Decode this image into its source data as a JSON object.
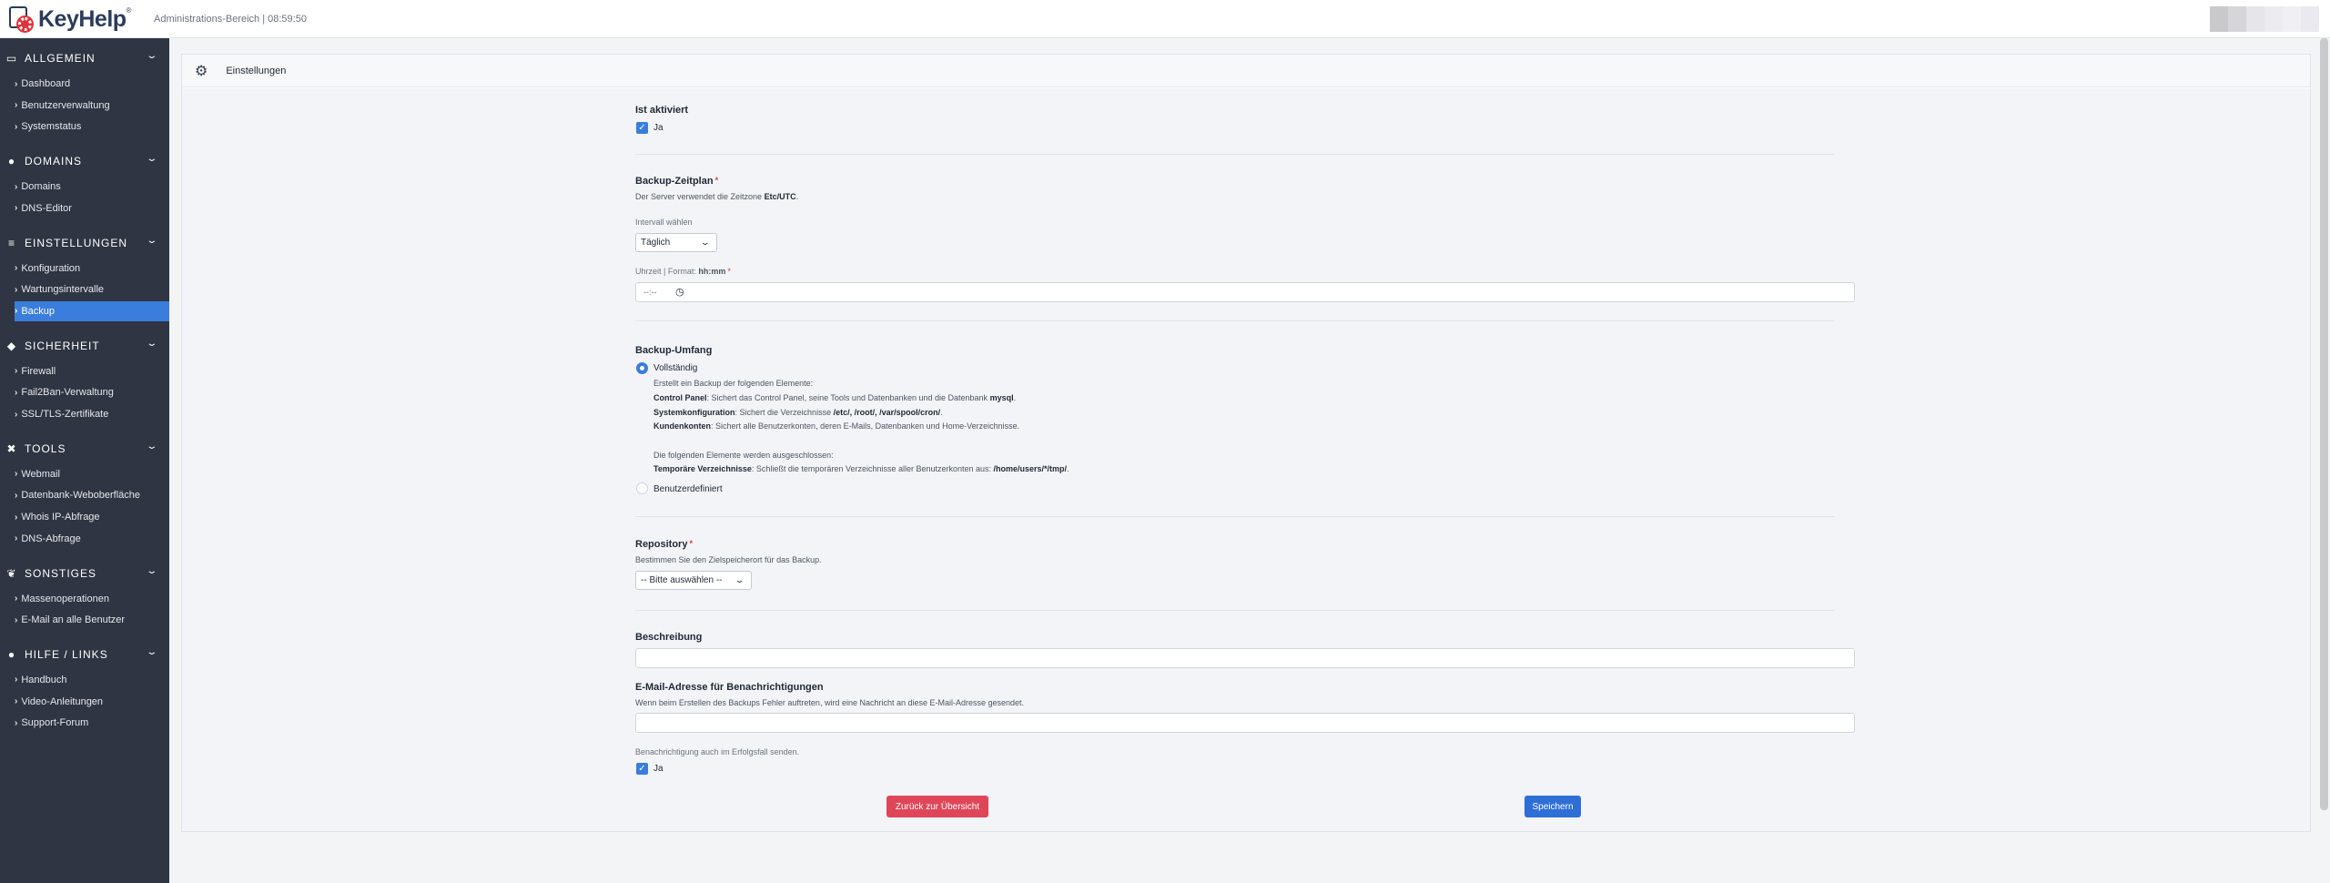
{
  "header": {
    "logo_text": "KeyHelp",
    "logo_mark": "®",
    "subtitle": "Administrations-Bereich | 08:59:50",
    "avatar_colors": [
      "#c9c9cc",
      "#d6d6d9",
      "#e6e6ea",
      "#ececf0",
      "#f0f0f4",
      "#e9e9ef"
    ]
  },
  "sidebar": {
    "sections": [
      {
        "title": "ALLGEMEIN",
        "icon": "monitor-icon",
        "glyph": "▭",
        "items": [
          "Dashboard",
          "Benutzerverwaltung",
          "Systemstatus"
        ]
      },
      {
        "title": "DOMAINS",
        "icon": "globe-icon",
        "glyph": "●",
        "items": [
          "Domains",
          "DNS-Editor"
        ]
      },
      {
        "title": "EINSTELLUNGEN",
        "icon": "sliders-icon",
        "glyph": "≡",
        "items": [
          "Konfiguration",
          "Wartungsintervalle",
          "Backup"
        ]
      },
      {
        "title": "SICHERHEIT",
        "icon": "shield-icon",
        "glyph": "◆",
        "items": [
          "Firewall",
          "Fail2Ban-Verwaltung",
          "SSL/TLS-Zertifikate"
        ]
      },
      {
        "title": "TOOLS",
        "icon": "tools-icon",
        "glyph": "✖",
        "items": [
          "Webmail",
          "Datenbank-Weboberfläche",
          "Whois IP-Abfrage",
          "DNS-Abfrage"
        ]
      },
      {
        "title": "SONSTIGES",
        "icon": "leaf-icon",
        "glyph": "❦",
        "items": [
          "Massenoperationen",
          "E-Mail an alle Benutzer"
        ]
      },
      {
        "title": "HILFE / LINKS",
        "icon": "info-icon",
        "glyph": "●",
        "items": [
          "Handbuch",
          "Video-Anleitungen",
          "Support-Forum"
        ]
      }
    ],
    "active_item": "Backup"
  },
  "card": {
    "title": "Einstellungen"
  },
  "form": {
    "active": {
      "label": "Ist aktiviert",
      "option": "Ja",
      "checked": true
    },
    "schedule": {
      "label": "Backup-Zeitplan",
      "required": "*",
      "hint_prefix": "Der Server verwendet die Zeitzone ",
      "hint_tz": "Etc/UTC",
      "hint_suffix": ".",
      "interval_label": "Intervall wählen",
      "interval_value": "Täglich",
      "time_label_prefix": "Uhrzeit | Format: ",
      "time_format": "hh:mm",
      "time_placeholder": "--:--"
    },
    "scope": {
      "label": "Backup-Umfang",
      "option_full": "Vollständig",
      "full_intro": "Erstellt ein Backup der folgenden Elemente:",
      "line1_label": "Control Panel",
      "line1_text": ": Sichert das Control Panel, seine Tools und Datenbanken und die Datenbank ",
      "line1_db": "mysql",
      "line1_end": ".",
      "line2_label": "Systemkonfiguration",
      "line2_text": ": Sichert die Verzeichnisse ",
      "line2_paths": "/etc/, /root/, /var/spool/cron/",
      "line2_end": ".",
      "line3_label": "Kundenkonten",
      "line3_text": ": Sichert alle Benutzerkonten, deren E-Mails, Datenbanken und Home-Verzeichnisse.",
      "excluded_intro": "Die folgenden Elemente werden ausgeschlossen:",
      "line4_label": "Temporäre Verzeichnisse",
      "line4_text": ": Schließt die temporären Verzeichnisse aller Benutzerkonten aus: ",
      "line4_path": "/home/users/*/tmp/",
      "line4_end": ".",
      "option_custom": "Benutzerdefiniert"
    },
    "repository": {
      "label": "Repository",
      "required": "*",
      "hint": "Bestimmen Sie den Zielspeicherort für das Backup.",
      "select_value": "-- Bitte auswählen --"
    },
    "description": {
      "label": "Beschreibung",
      "value": ""
    },
    "email": {
      "label": "E-Mail-Adresse für Benachrichtigungen",
      "hint": "Wenn beim Erstellen des Backups Fehler auftreten, wird eine Nachricht an diese E-Mail-Adresse gesendet.",
      "value": "",
      "success_label": "Benachrichtigung auch im Erfolgsfall senden.",
      "success_option": "Ja",
      "success_checked": true
    },
    "buttons": {
      "back": "Zurück zur Übersicht",
      "save": "Speichern"
    }
  }
}
